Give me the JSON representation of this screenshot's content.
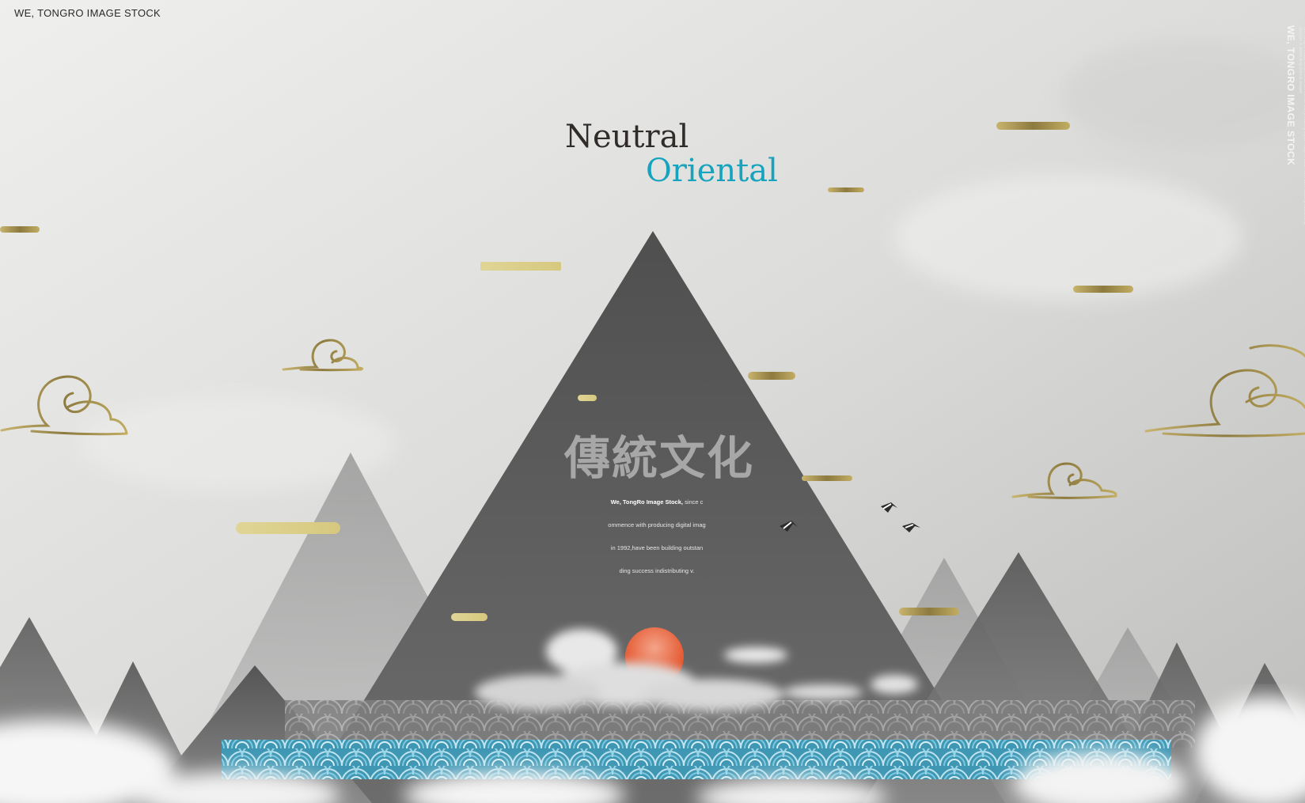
{
  "brand": "WE, TONGRO IMAGE STOCK",
  "vertical_brand": "WE, TONGRO IMAGE STOCK",
  "vertical_fine_print": "We, TongRo Image Stock, since commence with producing digital image in 1992, have been building outstanding success in distributing various images",
  "title": {
    "line1": "Neutral",
    "line2": "Oriental"
  },
  "headline_cjk": "傳統文化",
  "body": {
    "bold": "We, TongRo Image Stock,",
    "line1_rest": " since c",
    "line2": "ommence with producing digital imag",
    "line3": "in 1992,have been building outstan",
    "line4": "ding success indistributing v."
  },
  "colors": {
    "sky": "#d9d8d6",
    "mountain_main": "#5a5a5a",
    "accent_teal": "#17a3bd",
    "gold": "#a8924f",
    "sun": "#e9633d",
    "wave_blue": "#4fb3cf"
  },
  "icons": [
    "cloud-swirl-icon",
    "crane-icon",
    "sun-icon",
    "wave-pattern-icon"
  ]
}
